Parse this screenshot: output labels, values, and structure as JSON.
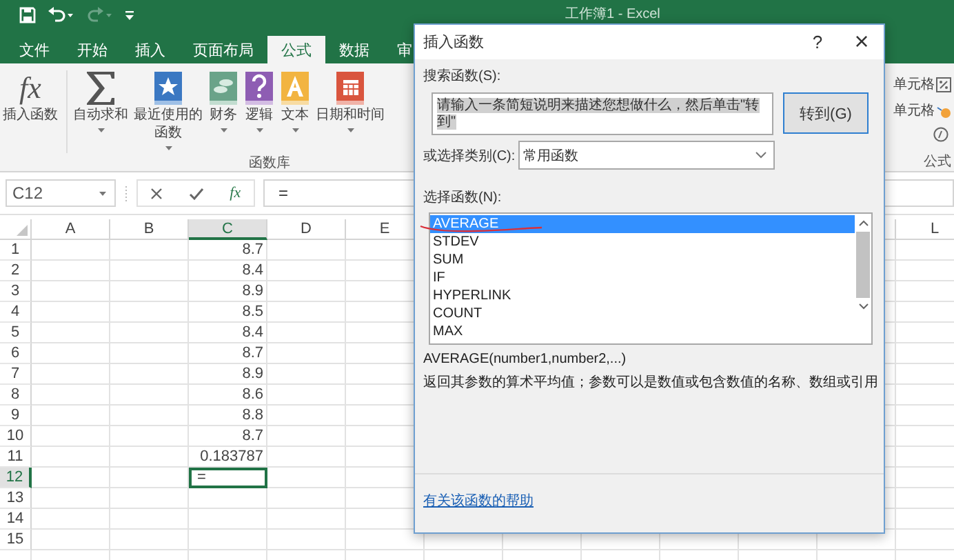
{
  "app": {
    "title": "工作簿1 - Excel"
  },
  "ribbon_tabs": [
    {
      "label": "文件",
      "selected": false
    },
    {
      "label": "开始",
      "selected": false
    },
    {
      "label": "插入",
      "selected": false
    },
    {
      "label": "页面布局",
      "selected": false
    },
    {
      "label": "公式",
      "selected": true
    },
    {
      "label": "数据",
      "selected": false
    },
    {
      "label": "审",
      "selected": false
    }
  ],
  "ribbon_buttons": [
    {
      "kind": "fx",
      "icon_text": "fx",
      "lines": [
        "插入函数"
      ],
      "dropdown": false
    },
    {
      "kind": "sigma",
      "lines": [
        "自动求和"
      ],
      "dropdown": true
    },
    {
      "kind": "recent",
      "lines": [
        "最近使用的",
        "函数"
      ],
      "dropdown": true
    },
    {
      "kind": "finance",
      "lines": [
        "财务"
      ],
      "dropdown": true
    },
    {
      "kind": "logic",
      "lines": [
        "逻辑"
      ],
      "dropdown": true
    },
    {
      "kind": "text",
      "lines": [
        "文本"
      ],
      "dropdown": true
    },
    {
      "kind": "date",
      "lines": [
        "日期和时间"
      ],
      "dropdown": true
    }
  ],
  "ribbon_group": "函数库",
  "ribbon_right": {
    "items": [
      {
        "label": "单元格",
        "kind": "percent"
      },
      {
        "label": "单元格",
        "kind": "warning"
      }
    ],
    "group": "公式"
  },
  "formula_bar": {
    "name_box": "C12",
    "fx": "fx",
    "formula": "="
  },
  "sheet": {
    "columns": [
      {
        "label": "A",
        "selected": false
      },
      {
        "label": "B",
        "selected": false
      },
      {
        "label": "C",
        "selected": true
      },
      {
        "label": "D",
        "selected": false
      },
      {
        "label": "E",
        "selected": false
      }
    ],
    "right_column": "L",
    "rows": [
      {
        "number": "1",
        "c": "8.7",
        "selected": false
      },
      {
        "number": "2",
        "c": "8.4",
        "selected": false
      },
      {
        "number": "3",
        "c": "8.9",
        "selected": false
      },
      {
        "number": "4",
        "c": "8.5",
        "selected": false
      },
      {
        "number": "5",
        "c": "8.4",
        "selected": false
      },
      {
        "number": "6",
        "c": "8.7",
        "selected": false
      },
      {
        "number": "7",
        "c": "8.9",
        "selected": false
      },
      {
        "number": "8",
        "c": "8.6",
        "selected": false
      },
      {
        "number": "9",
        "c": "8.8",
        "selected": false
      },
      {
        "number": "10",
        "c": "8.7",
        "selected": false
      },
      {
        "number": "11",
        "c": "0.183787",
        "selected": false
      },
      {
        "number": "12",
        "c": "=",
        "selected": true
      },
      {
        "number": "13",
        "selected": false
      },
      {
        "number": "14",
        "selected": false
      },
      {
        "number": "15",
        "selected": false
      }
    ]
  },
  "dialog": {
    "title": "插入函数",
    "help": "?",
    "close": "×",
    "search_label": "搜索函数(S):",
    "search_value": "请输入一条简短说明来描述您想做什么，然后单击\"转到\"",
    "go_button": "转到(G)",
    "category_label": "或选择类别(C):",
    "category_value": "常用函数",
    "list_label": "选择函数(N):",
    "functions": [
      {
        "name": "AVERAGE",
        "selected": true
      },
      {
        "name": "STDEV",
        "selected": false
      },
      {
        "name": "SUM",
        "selected": false
      },
      {
        "name": "IF",
        "selected": false
      },
      {
        "name": "HYPERLINK",
        "selected": false
      },
      {
        "name": "COUNT",
        "selected": false
      },
      {
        "name": "MAX",
        "selected": false
      }
    ],
    "syntax": "AVERAGE(number1,number2,...)",
    "description": "返回其参数的算术平均值；参数可以是数值或包含数值的名称、数组或引用",
    "help_link": "有关该函数的帮助"
  }
}
